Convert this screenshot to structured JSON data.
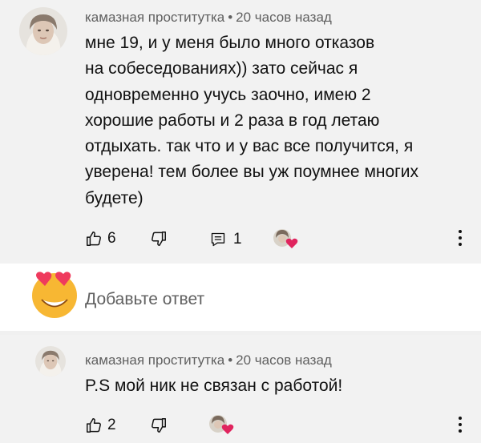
{
  "comment": {
    "author": "камазная проститутка",
    "separator": "•",
    "time": "20 часов назад",
    "lines": [
      "мне 19, и у меня было много отказов",
      "на собеседованиях)) зато сейчас я",
      "одновременно учусь заочно, имею 2",
      "хорошие работы и 2 раза в год летаю",
      "отдыхать. так что и у вас все получится, я",
      "уверена! тем более вы уж поумнее многих",
      "будете)"
    ],
    "likes": "6",
    "replies": "1",
    "like_icon": "thumbs-up-icon",
    "dislike_icon": "thumbs-down-icon",
    "reply_icon": "reply-comment-icon",
    "more_icon": "more-vertical-icon"
  },
  "reply_box": {
    "placeholder": "Добавьте ответ",
    "emoji_icon": "heart-eyes-emoji-icon"
  },
  "reply": {
    "author": "камазная проститутка",
    "separator": "•",
    "time": "20 часов назад",
    "text": "P.S мой ник не связан с работой!",
    "likes": "2"
  },
  "colors": {
    "comment_bg": "#f2f2f2",
    "meta_text": "#606060",
    "heart": "#e0245e",
    "emoji_face": "#f7b733"
  }
}
